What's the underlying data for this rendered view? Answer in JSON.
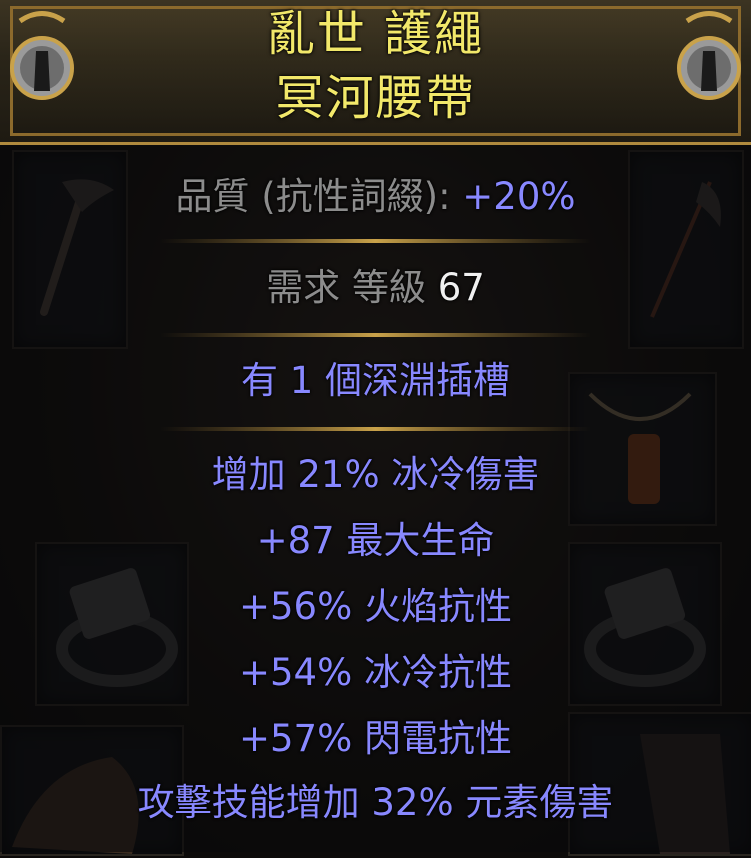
{
  "item": {
    "name_line1": "亂世 護繩",
    "name_line2": "冥河腰帶"
  },
  "properties": {
    "quality_label": "品質 (抗性詞綴): ",
    "quality_value": "+20%",
    "requirement_label": "需求 等級 ",
    "requirement_value": "67",
    "implicit": "有 1 個深淵插槽"
  },
  "modifiers": [
    "增加 21% 冰冷傷害",
    "+87 最大生命",
    "+56% 火焰抗性",
    "+54% 冰冷抗性",
    "+57% 閃電抗性",
    "攻擊技能增加 32% 元素傷害"
  ],
  "colors": {
    "name": "#f2e86a",
    "label": "#8c8c8c",
    "value": "#f0f0f0",
    "magic_mod": "#8888ff",
    "frame": "#b08a3e"
  },
  "icons": [
    "ornament-shield-icon",
    "axe-icon",
    "pole-axe-icon",
    "amulet-icon",
    "ring-icon",
    "gloves-icon",
    "boots-icon"
  ]
}
